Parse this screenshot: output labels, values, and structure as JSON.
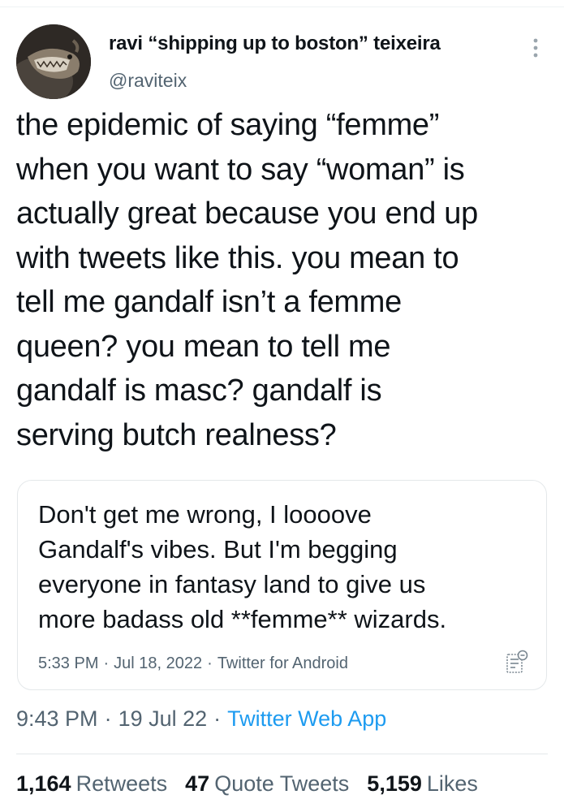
{
  "author": {
    "display_name": "ravi “shipping up to boston” teixeira",
    "handle": "@raviteix"
  },
  "tweet": {
    "text": "the epidemic of saying “femme”\nwhen you want to say “woman” is\nactually great because you end up\nwith tweets like this. you mean to\ntell me gandalf isn’t a femme\nqueen? you mean to tell me\ngandalf is masc? gandalf is\nserving butch realness?",
    "time": "9:43 PM",
    "date": "19 Jul 22",
    "source": "Twitter Web App"
  },
  "quote": {
    "text": "Don't get me wrong, I loooove\nGandalf's vibes. But I'm begging\neveryone in fantasy land to give us\nmore badass old **femme** wizards.",
    "time": "5:33 PM",
    "date": "Jul 18, 2022",
    "source": "Twitter for Android"
  },
  "stats": {
    "retweets_count": "1,164",
    "retweets_label": "Retweets",
    "quotes_count": "47",
    "quotes_label": "Quote Tweets",
    "likes_count": "5,159",
    "likes_label": "Likes"
  },
  "separator": "·",
  "icons": {
    "more": "more-vertical-icon",
    "notes": "notes-icon"
  },
  "colors": {
    "link": "#1d9bf0",
    "secondary_text": "#536471",
    "primary_text": "#0f1419",
    "border": "#e4e8ea"
  }
}
